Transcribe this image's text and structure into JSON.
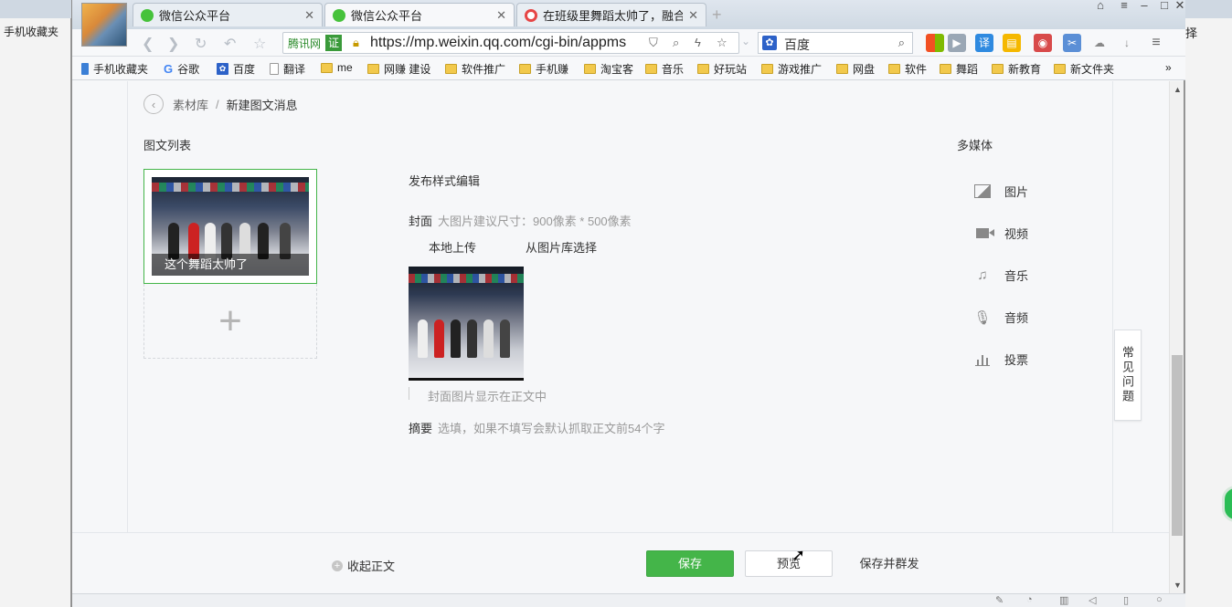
{
  "background": {
    "left_fav": "手机收藏夹",
    "right_text": "择"
  },
  "browser": {
    "tabs": [
      {
        "label": "微信公众平台",
        "icon": "wechat-icon"
      },
      {
        "label": "微信公众平台",
        "icon": "wechat-icon"
      },
      {
        "label": "在班级里舞蹈太帅了，融合好",
        "icon": "video-play-icon"
      }
    ],
    "close_glyph": "✕",
    "new_tab_glyph": "+",
    "address": {
      "provider": "腾讯网",
      "cert": "证",
      "url": "https://mp.weixin.qq.com/cgi-bin/appms"
    },
    "search": {
      "engine": "百度"
    },
    "translate_ext": "译",
    "favorites": [
      {
        "label": "手机收藏夹",
        "icon": "phone-icon"
      },
      {
        "label": "谷歌",
        "icon": "google-icon"
      },
      {
        "label": "百度",
        "icon": "baidu-icon"
      },
      {
        "label": "翻译",
        "icon": "page-icon"
      },
      {
        "label": "me",
        "icon": "folder-icon"
      },
      {
        "label": "网赚 建设",
        "icon": "folder-icon"
      },
      {
        "label": "软件推广",
        "icon": "folder-icon"
      },
      {
        "label": "手机赚",
        "icon": "folder-icon"
      },
      {
        "label": "淘宝客",
        "icon": "folder-icon"
      },
      {
        "label": "音乐",
        "icon": "folder-icon"
      },
      {
        "label": "好玩站",
        "icon": "folder-icon"
      },
      {
        "label": "游戏推广",
        "icon": "folder-icon"
      },
      {
        "label": "网盘",
        "icon": "folder-icon"
      },
      {
        "label": "软件",
        "icon": "folder-icon"
      },
      {
        "label": "舞蹈",
        "icon": "folder-icon"
      },
      {
        "label": "新教育",
        "icon": "folder-icon"
      },
      {
        "label": "新文件夹",
        "icon": "folder-icon"
      }
    ],
    "favorites_more": "»"
  },
  "page": {
    "breadcrumb": {
      "parent": "素材库",
      "separator": "/",
      "current": "新建图文消息"
    },
    "list_title": "图文列表",
    "article": {
      "title": "这个舞蹈太帅了"
    },
    "add_glyph": "+",
    "editor": {
      "section_title": "发布样式编辑",
      "cover_label": "封面",
      "cover_hint": "大图片建议尺寸：900像素 * 500像素",
      "upload_local": "本地上传",
      "upload_library": "从图片库选择",
      "cover_in_body": "封面图片显示在正文中",
      "abstract_label": "摘要",
      "abstract_hint": "选填，如果不填写会默认抓取正文前54个字"
    },
    "media": {
      "title": "多媒体",
      "items": [
        {
          "label": "图片",
          "icon": "image-icon"
        },
        {
          "label": "视频",
          "icon": "video-icon"
        },
        {
          "label": "音乐",
          "icon": "music-icon"
        },
        {
          "label": "音频",
          "icon": "microphone-icon"
        },
        {
          "label": "投票",
          "icon": "vote-icon"
        }
      ]
    },
    "faq": "常见问题",
    "footer": {
      "collapse": "收起正文",
      "save": "保存",
      "preview": "预览",
      "save_and_send": "保存并群发"
    }
  },
  "colors": {
    "accent": "#44b549",
    "border": "#e4e7eb",
    "hint": "#999999"
  }
}
